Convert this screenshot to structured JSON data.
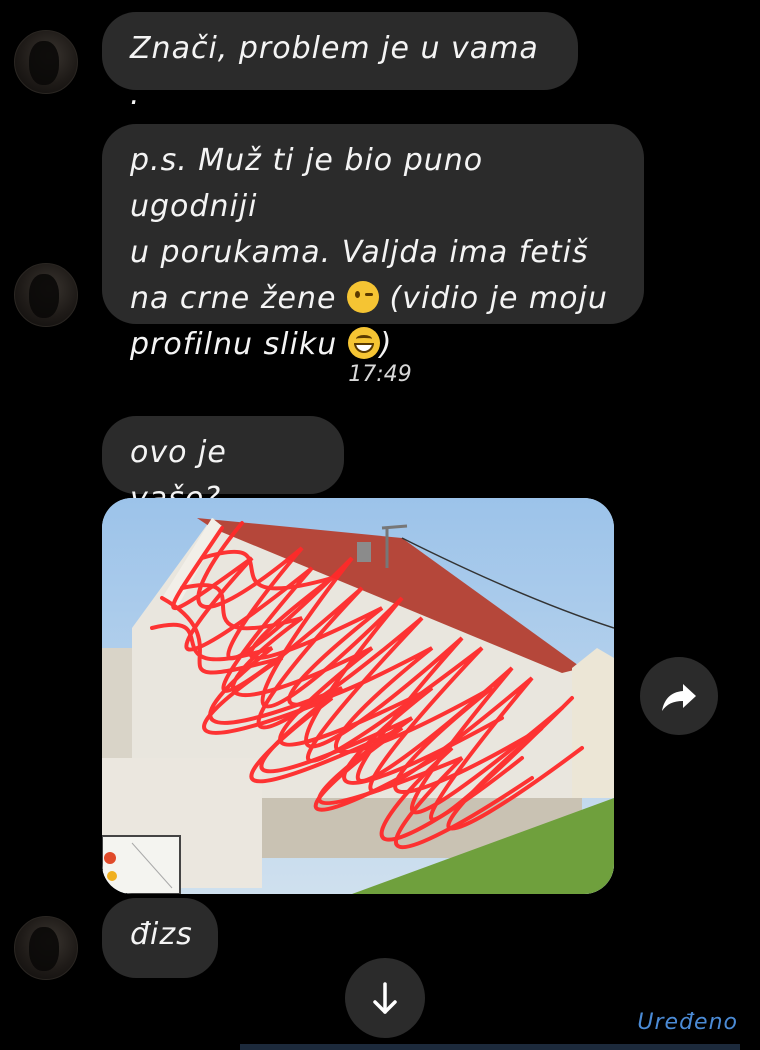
{
  "messages": [
    {
      "text": "Znači, problem je u vama ."
    },
    {
      "line1": "p.s. Muž ti je bio puno ugodniji",
      "line2": "u porukama. Valjda ima fetiš",
      "line3a": "na crne žene",
      "line3b": "(vidio je moju",
      "line4a": "profilnu sliku",
      "line4b": ")"
    },
    {
      "text": "ovo je vaše?"
    },
    {
      "text": "đizs"
    }
  ],
  "timestamp": "17:49",
  "emojis": [
    "winking-face",
    "grinning-face"
  ],
  "photo": {
    "description_icon": "house-photo-scribbled"
  },
  "status": {
    "edited_label": "Uređeno"
  },
  "colors": {
    "background": "#000000",
    "bubble": "#2b2b2b",
    "scribble": "#ff2a2a",
    "edited": "#4b8bd6"
  }
}
